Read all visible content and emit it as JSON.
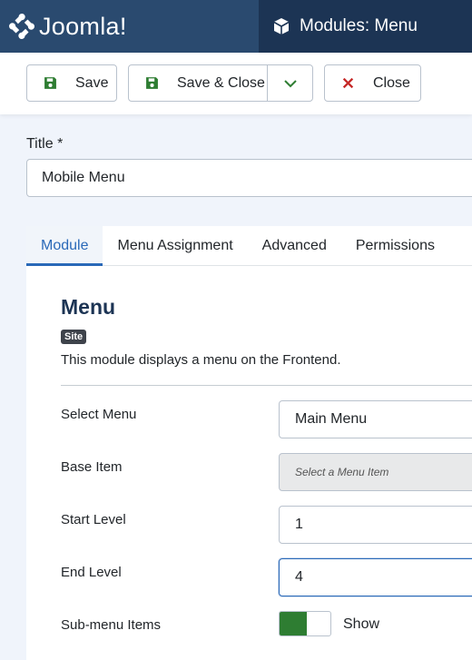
{
  "header": {
    "logo_text": "Joomla!",
    "page_title": "Modules: Menu"
  },
  "toolbar": {
    "save_label": "Save",
    "save_close_label": "Save & Close",
    "close_label": "Close"
  },
  "title_field": {
    "label": "Title *",
    "value": "Mobile Menu"
  },
  "tabs": [
    {
      "label": "Module",
      "active": true
    },
    {
      "label": "Menu Assignment",
      "active": false
    },
    {
      "label": "Advanced",
      "active": false
    },
    {
      "label": "Permissions",
      "active": false
    }
  ],
  "module": {
    "heading": "Menu",
    "badge": "Site",
    "description": "This module displays a menu on the Frontend."
  },
  "fields": {
    "select_menu": {
      "label": "Select Menu",
      "value": "Main Menu"
    },
    "base_item": {
      "label": "Base Item",
      "placeholder": "Select a Menu Item"
    },
    "start_level": {
      "label": "Start Level",
      "value": "1"
    },
    "end_level": {
      "label": "End Level",
      "value": "4"
    },
    "submenu_items": {
      "label": "Sub-menu Items",
      "state_label": "Show"
    }
  },
  "colors": {
    "header_bg": "#1c3454",
    "logo_bg": "#2a4a6f",
    "accent": "#2a69b8",
    "save_icon": "#2e7d32",
    "close_icon": "#c52827",
    "switch_on": "#2e7d32"
  }
}
